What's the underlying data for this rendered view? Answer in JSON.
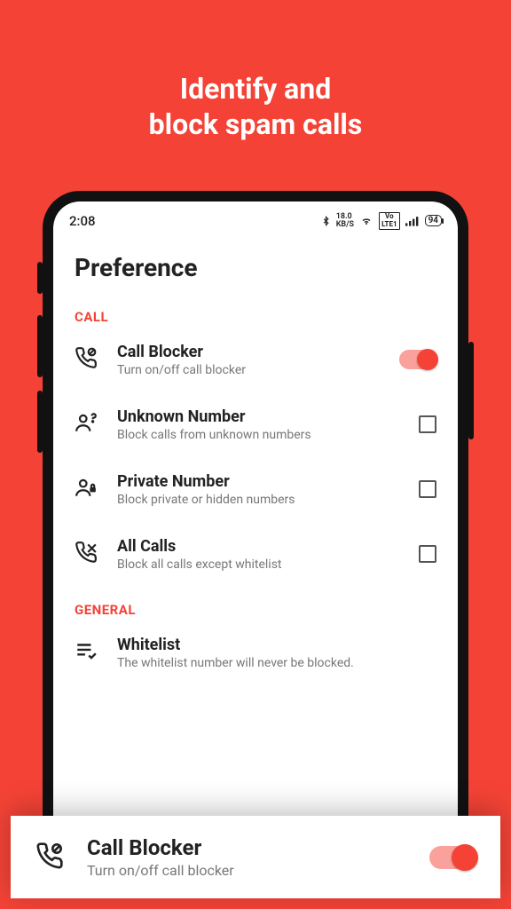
{
  "headline_l1": "Identify and",
  "headline_l2": "block spam calls",
  "status": {
    "time": "2:08",
    "data_rate_top": "18.0",
    "data_rate_bottom": "KB/S",
    "lte_top": "Vo",
    "lte_bottom": "LTE1",
    "battery": "94"
  },
  "page_title": "Preference",
  "sections": {
    "call": "CALL",
    "general": "GENERAL"
  },
  "items": {
    "call_blocker": {
      "title": "Call Blocker",
      "sub": "Turn on/off call blocker"
    },
    "unknown": {
      "title": "Unknown Number",
      "sub": "Block calls from unknown numbers"
    },
    "private": {
      "title": "Private Number",
      "sub": "Block private or hidden numbers"
    },
    "all_calls": {
      "title": "All Calls",
      "sub": "Block all calls except whitelist"
    },
    "whitelist": {
      "title": "Whitelist",
      "sub": "The whitelist number will never be blocked."
    }
  },
  "overlay": {
    "title": "Call Blocker",
    "sub": "Turn on/off call blocker"
  }
}
